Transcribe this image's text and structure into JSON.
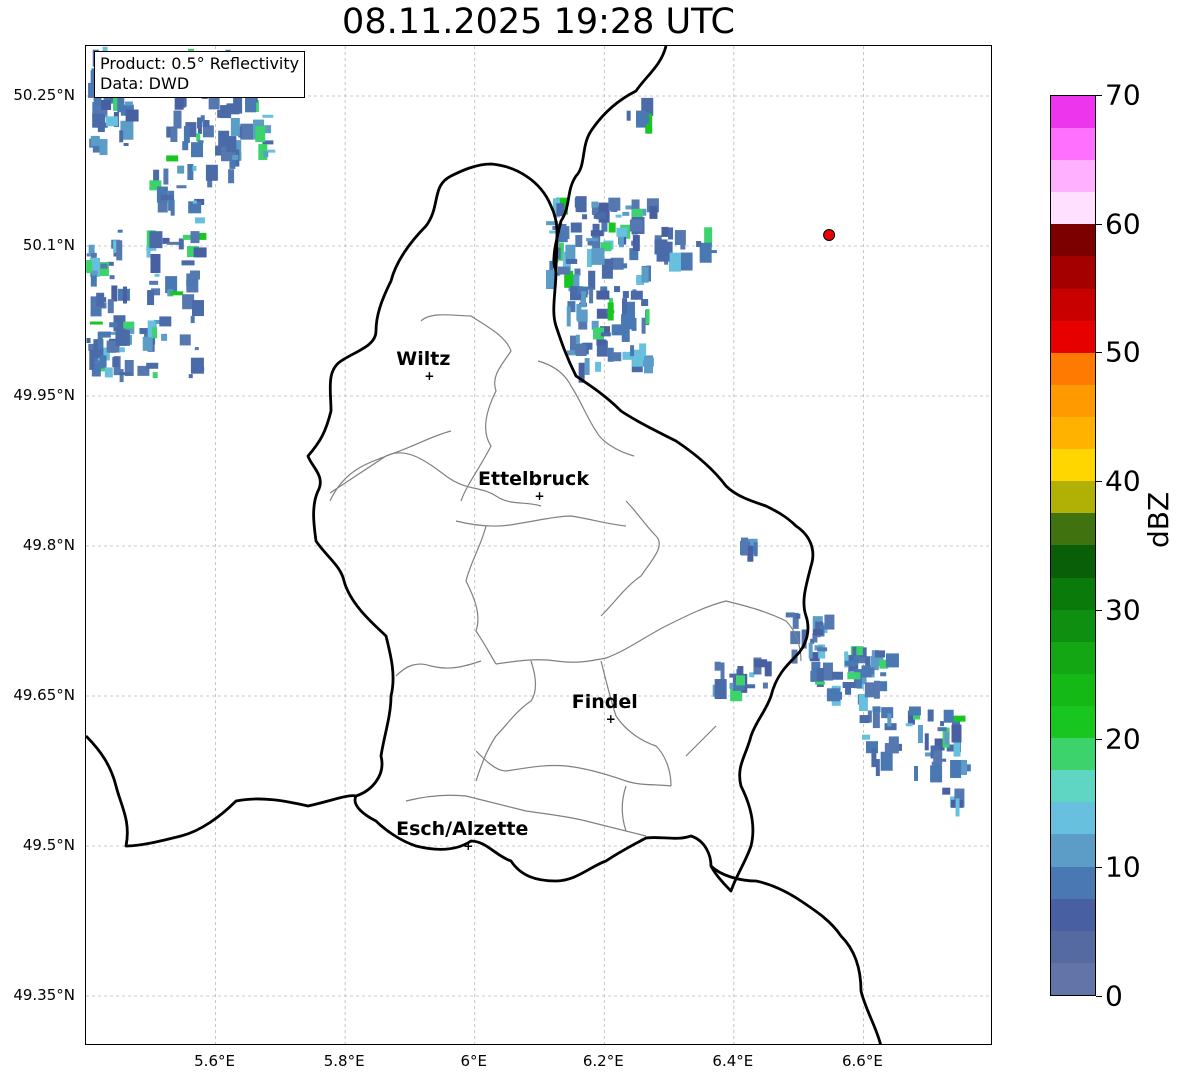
{
  "title": "08.11.2025 19:28 UTC",
  "info": {
    "product": "Product: 0.5° Reflectivity",
    "data": "Data: DWD"
  },
  "axes": {
    "lat_ticks": [
      "50.25°N",
      "50.1°N",
      "49.95°N",
      "49.8°N",
      "49.65°N",
      "49.5°N",
      "49.35°N"
    ],
    "lon_ticks": [
      "5.6°E",
      "5.8°E",
      "6°E",
      "6.2°E",
      "6.4°E",
      "6.6°E"
    ],
    "lat_values": [
      50.25,
      50.1,
      49.95,
      49.8,
      49.65,
      49.5,
      49.35
    ],
    "lon_values": [
      5.6,
      5.8,
      6.0,
      6.2,
      6.4,
      6.6
    ],
    "lon_range": [
      5.4,
      6.8
    ],
    "lat_range": [
      49.3,
      50.3
    ]
  },
  "cities": [
    {
      "name": "Wiltz",
      "lon": 5.93,
      "lat": 49.97
    },
    {
      "name": "Ettelbruck",
      "lon": 6.1,
      "lat": 49.85
    },
    {
      "name": "Findel",
      "lon": 6.21,
      "lat": 49.627
    },
    {
      "name": "Esch/Alzette",
      "lon": 5.99,
      "lat": 49.5
    }
  ],
  "radar_site": {
    "lon": 6.547,
    "lat": 50.111,
    "color": "#e8000b"
  },
  "colorbar": {
    "label": "dBZ",
    "ticks": [
      "0",
      "10",
      "20",
      "30",
      "40",
      "50",
      "60",
      "70"
    ],
    "min": 0,
    "max": 70,
    "colors": [
      "#6374a8",
      "#556aa0",
      "#4860a1",
      "#4a78b2",
      "#5c9dc8",
      "#67c0de",
      "#5fd6c2",
      "#3dd36c",
      "#17c61e",
      "#14b915",
      "#13a813",
      "#0f8f0f",
      "#0a7a0a",
      "#085f08",
      "#417210",
      "#b0b005",
      "#ffd600",
      "#ffb300",
      "#ff9a00",
      "#ff7a00",
      "#e60000",
      "#c80000",
      "#a50000",
      "#7d0000",
      "#ffe0ff",
      "#ffb0ff",
      "#ff70ff",
      "#ee35ee"
    ]
  }
}
